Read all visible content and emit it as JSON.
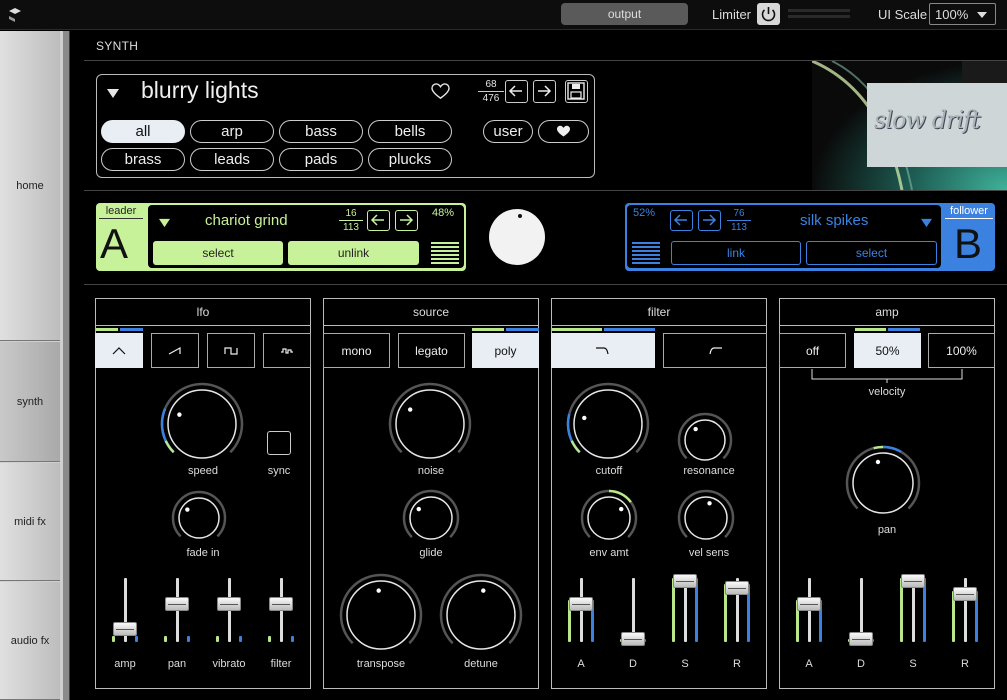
{
  "topbar": {
    "output_label": "output",
    "limiter_label": "Limiter",
    "ui_scale_label": "UI Scale",
    "ui_scale_value": "100%"
  },
  "nav": {
    "tabs": [
      "home",
      "synth",
      "midi fx",
      "audio fx"
    ],
    "active": "synth"
  },
  "synth": {
    "section_label": "SYNTH",
    "preset": {
      "name": "blurry lights",
      "index": "68",
      "total": "476",
      "categories": [
        "all",
        "arp",
        "bass",
        "bells",
        "brass",
        "leads",
        "pads",
        "plucks"
      ],
      "active_category": "all",
      "user_label": "user"
    },
    "artwork_text": "slow drift",
    "layer_a": {
      "role": "leader",
      "letter": "A",
      "preset_name": "chariot grind",
      "index": "16",
      "total": "113",
      "level": "48%",
      "select_label": "select",
      "link_label": "unlink"
    },
    "layer_b": {
      "role": "follower",
      "letter": "B",
      "preset_name": "silk spikes",
      "index": "76",
      "total": "113",
      "level": "52%",
      "select_label": "select",
      "link_label": "link"
    },
    "crossfade": 0.55
  },
  "lfo": {
    "title": "lfo",
    "knobs": {
      "speed": "speed",
      "fade_in": "fade in"
    },
    "sync_label": "sync",
    "sliders": [
      "amp",
      "pan",
      "vibrato",
      "filter"
    ],
    "slider_levels": [
      0.2,
      0.6,
      0.6,
      0.6
    ]
  },
  "source": {
    "title": "source",
    "modes": [
      "mono",
      "legato",
      "poly"
    ],
    "active_mode": "poly",
    "knobs": {
      "noise": "noise",
      "glide": "glide",
      "transpose": "transpose",
      "detune": "detune"
    }
  },
  "filter": {
    "title": "filter",
    "knobs": {
      "cutoff": "cutoff",
      "resonance": "resonance",
      "env_amt": "env amt",
      "vel_sens": "vel sens"
    },
    "adsr": [
      "A",
      "D",
      "S",
      "R"
    ],
    "adsr_levels": [
      0.6,
      0.05,
      0.95,
      0.85
    ]
  },
  "amp": {
    "title": "amp",
    "velocity_options": [
      "off",
      "50%",
      "100%"
    ],
    "active_velocity": "50%",
    "velocity_label": "velocity",
    "pan_label": "pan",
    "adsr": [
      "A",
      "D",
      "S",
      "R"
    ],
    "adsr_levels": [
      0.6,
      0.05,
      0.95,
      0.75
    ]
  },
  "colors": {
    "leader": "#c8f29a",
    "follower": "#3b82e0",
    "accent_green": "#b9e88a",
    "accent_blue": "#3b82e0"
  }
}
